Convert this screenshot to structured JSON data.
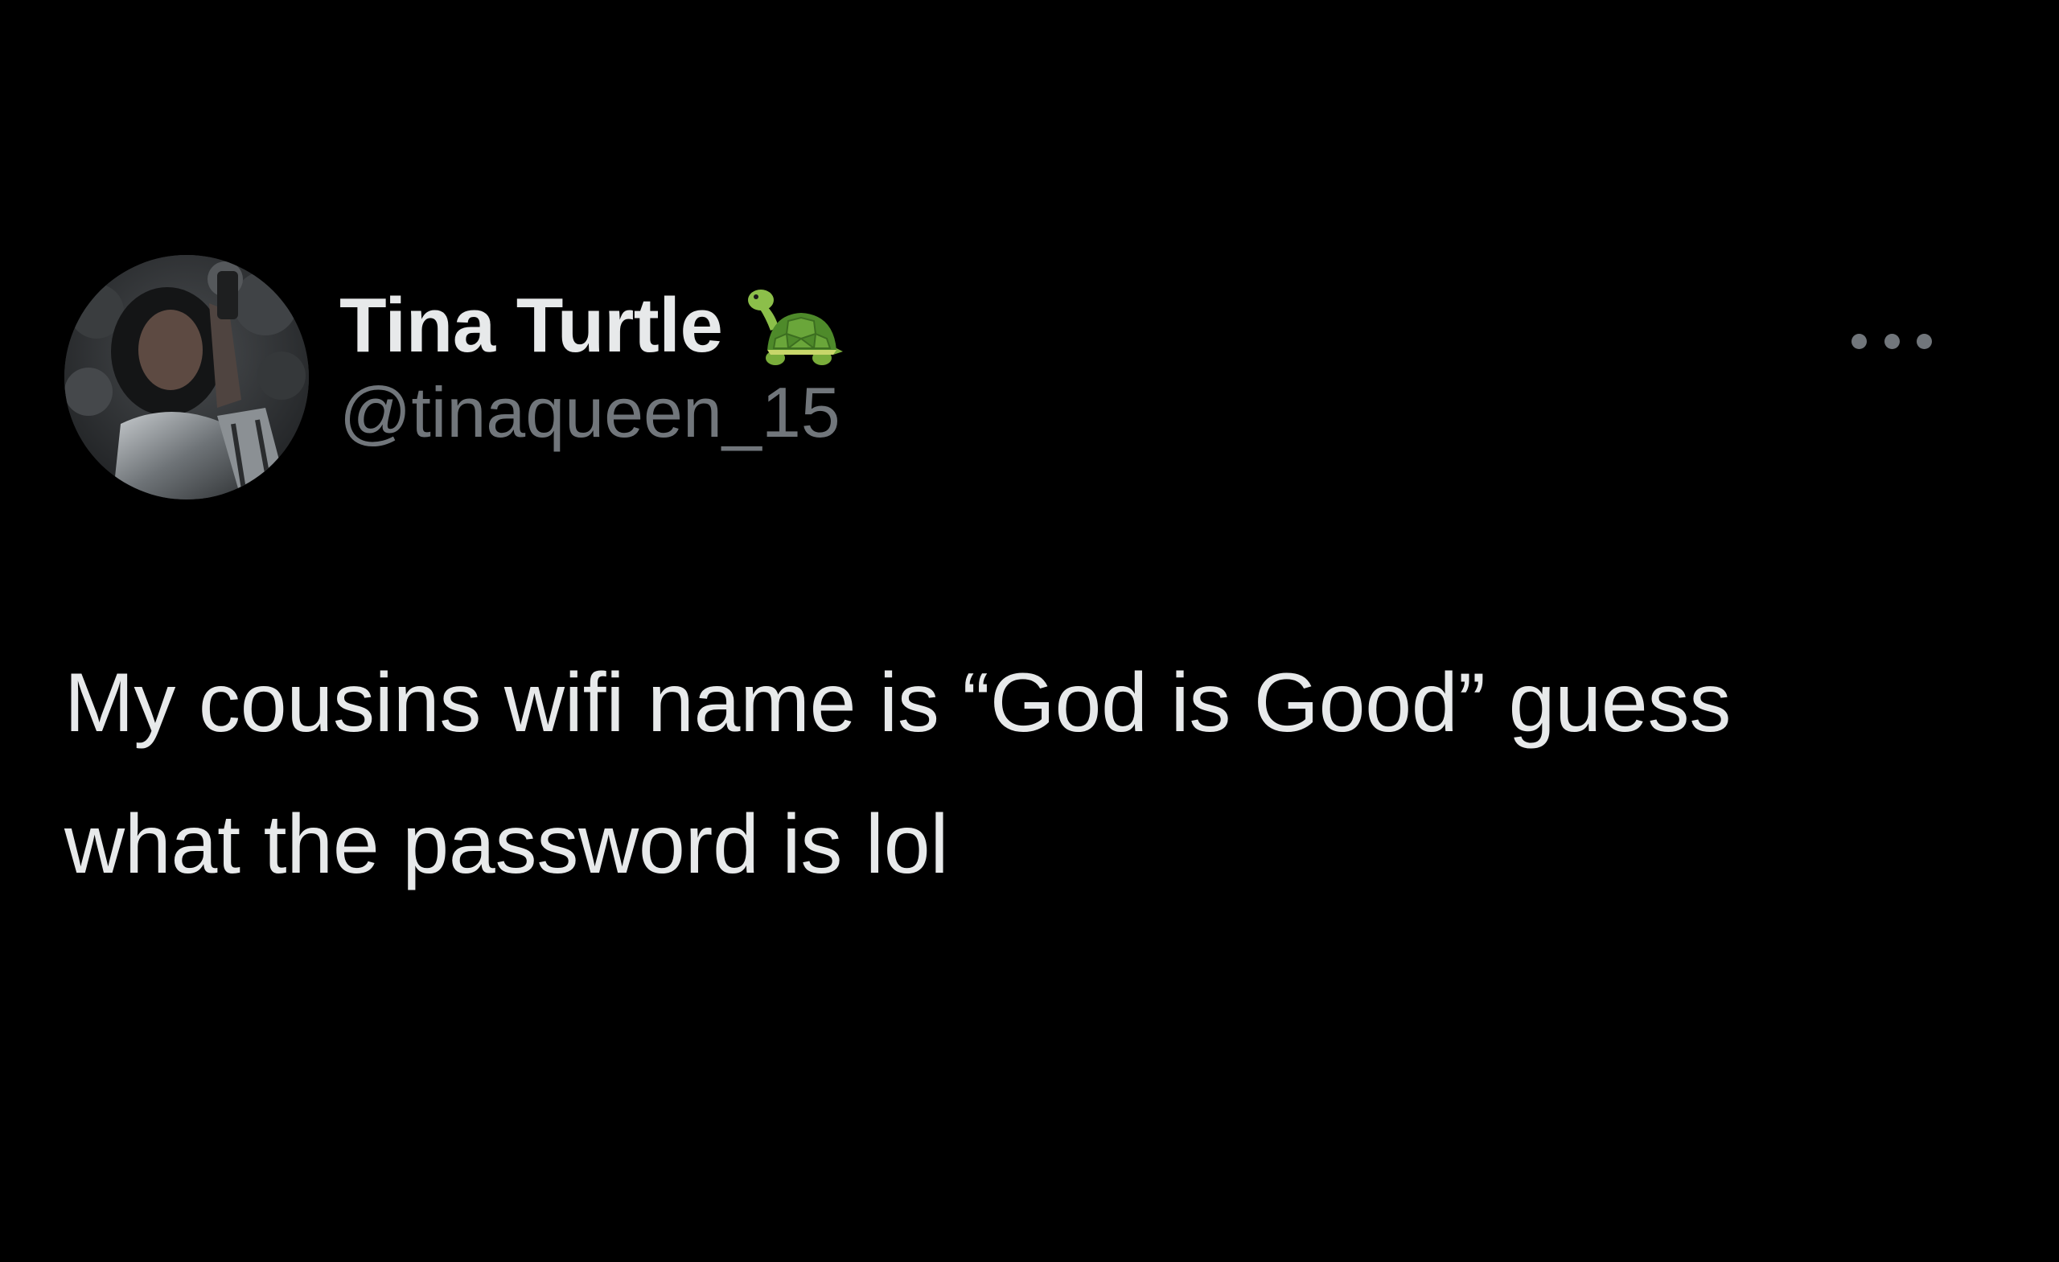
{
  "author": {
    "display_name": "Tina Turtle",
    "emoji_icon": "turtle-icon",
    "handle": "@tinaqueen_15"
  },
  "actions": {
    "more_icon": "more-horizontal-icon"
  },
  "tweet": {
    "text": "My cousins wifi name is “God is Good” guess\nwhat the password is lol"
  },
  "colors": {
    "background": "#000000",
    "primary_text": "#e7e9ea",
    "secondary_text": "#71767b"
  }
}
